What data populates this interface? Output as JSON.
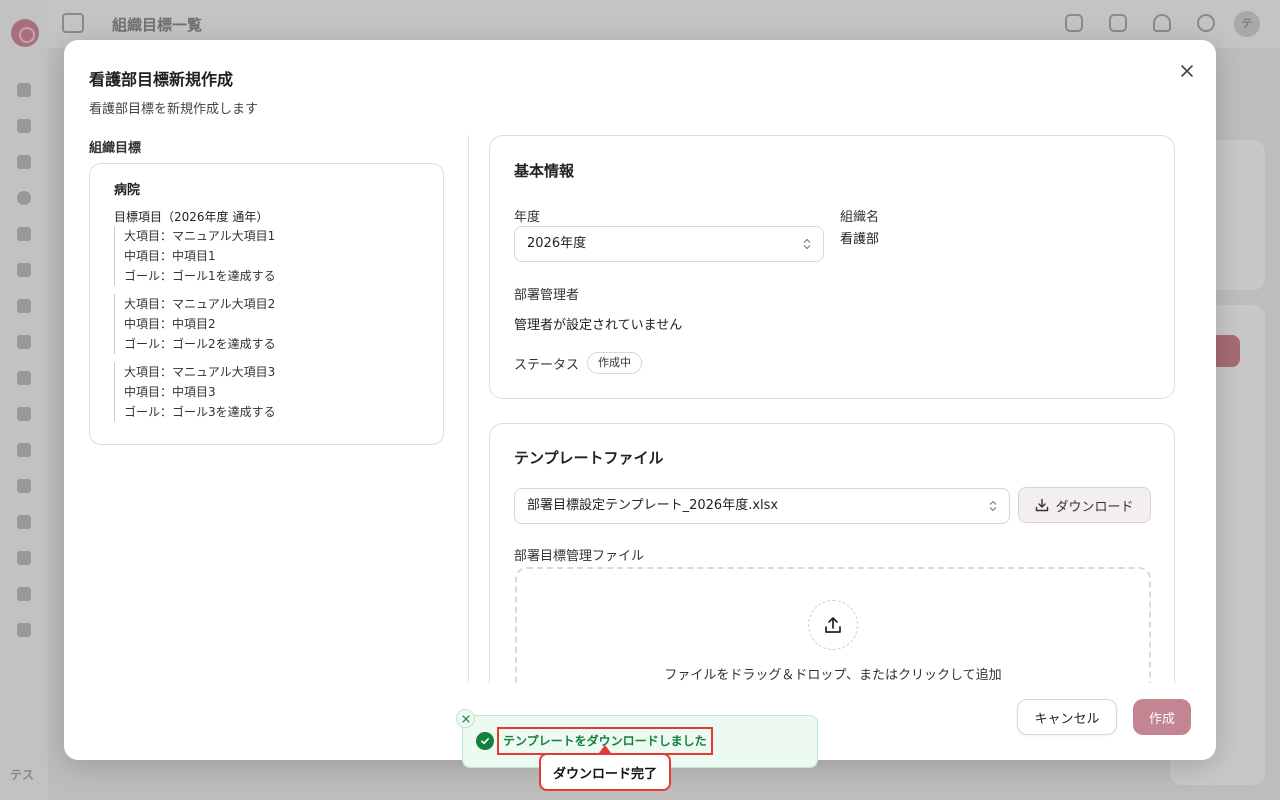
{
  "background": {
    "page_title": "組織目標一覧",
    "user_initials": "テス",
    "avatar_initial": "テ"
  },
  "modal": {
    "title": "看護部目標新規作成",
    "subtitle": "看護部目標を新規作成します",
    "close_icon": "close-icon"
  },
  "org_goals": {
    "label": "組織目標",
    "org_name": "病院",
    "period": "目標項目（2026年度 通年）",
    "groups": [
      {
        "major": "大項目：マニュアル大項目1",
        "middle": "中項目：中項目1",
        "goal": "ゴール：ゴール1を達成する"
      },
      {
        "major": "大項目：マニュアル大項目2",
        "middle": "中項目：中項目2",
        "goal": "ゴール：ゴール2を達成する"
      },
      {
        "major": "大項目：マニュアル大項目3",
        "middle": "中項目：中項目3",
        "goal": "ゴール：ゴール3を達成する"
      }
    ]
  },
  "basic_info": {
    "title": "基本情報",
    "year_label": "年度",
    "year_value": "2026年度",
    "org_label": "組織名",
    "org_value": "看護部",
    "manager_label": "部署管理者",
    "manager_value": "管理者が設定されていません",
    "status_label": "ステータス",
    "status_value": "作成中"
  },
  "template": {
    "title": "テンプレートファイル",
    "template_value": "部署目標設定テンプレート_2026年度.xlsx",
    "download_label": "ダウンロード",
    "file_label": "部署目標管理ファイル",
    "drop_text": "ファイルをドラッグ＆ドロップ、またはクリックして追加"
  },
  "footer": {
    "cancel_label": "キャンセル",
    "create_label": "作成"
  },
  "toast": {
    "message": "テンプレートをダウンロードしました"
  },
  "callout": {
    "text": "ダウンロード完了"
  },
  "colors": {
    "accent": "#c38592",
    "success": "#15803d",
    "highlight": "#e53935"
  }
}
